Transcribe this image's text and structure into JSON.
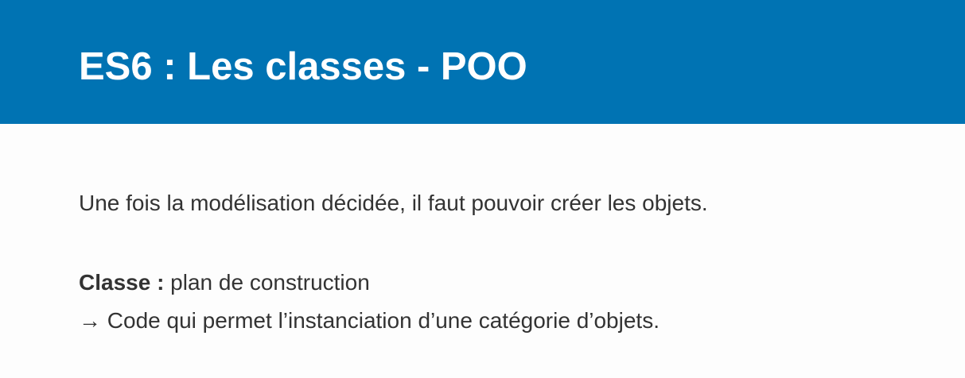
{
  "slide": {
    "title": "ES6 : Les classes - POO",
    "intro": "Une fois la modélisation décidée, il faut pouvoir créer les objets.",
    "definition": {
      "term": "Classe :",
      "text": " plan de construction"
    },
    "detail": "→ Code qui permet l’instanciation d’une catégorie d’objets."
  },
  "colors": {
    "header_background": "#0073b3",
    "title_text": "#ffffff",
    "body_text": "#333333",
    "page_background": "#fdfdfd"
  }
}
